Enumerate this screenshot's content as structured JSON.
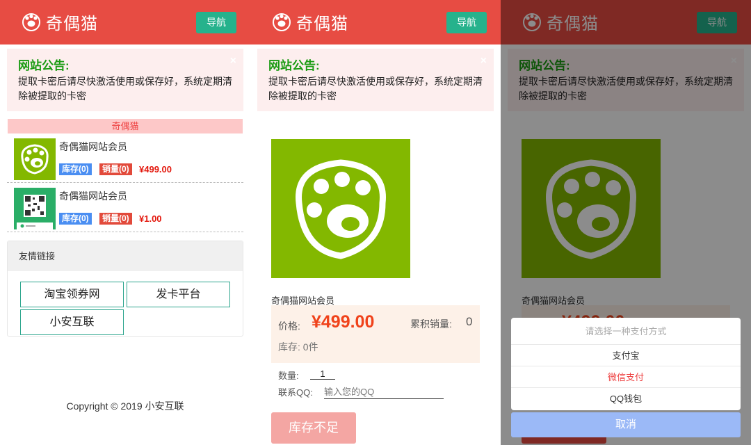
{
  "site": {
    "logo_text": "奇偶猫",
    "nav_label": "导航"
  },
  "notice": {
    "title": "网站公告:",
    "body": "提取卡密后请尽快激活使用或保存好，系统定期清除被提取的卡密",
    "close": "×"
  },
  "category": {
    "name": "奇偶猫"
  },
  "products": [
    {
      "name": "奇偶猫网站会员",
      "stock_label": "库存(0)",
      "sales_label": "销量(0)",
      "price": "¥499.00",
      "thumb_icon": "paw-logo-icon"
    },
    {
      "name": "奇偶猫网站会员",
      "stock_label": "库存(0)",
      "sales_label": "销量(0)",
      "price": "¥1.00",
      "thumb_icon": "wechat-qr-code-icon"
    }
  ],
  "links": {
    "title": "友情链接",
    "items": [
      "淘宝领券网",
      "发卡平台",
      "小安互联"
    ]
  },
  "footer": {
    "copyright": "Copyright © 2019 小安互联"
  },
  "detail": {
    "name": "奇偶猫网站会员",
    "price_label": "价格:",
    "price": "¥499.00",
    "sales_label": "累积销量:",
    "sales_value": "0",
    "stock_text": "库存: 0件",
    "qty_label": "数量:",
    "qty_value": "1",
    "qq_label": "联系QQ:",
    "qq_placeholder": "输入您的QQ",
    "buy_label": "库存不足"
  },
  "payment": {
    "title": "请选择一种支付方式",
    "options": [
      "支付宝",
      "微信支付",
      "QQ钱包"
    ],
    "cancel": "取消"
  },
  "colors": {
    "header": "#e74c43",
    "nav_button": "#26b28c",
    "price": "#f0421a",
    "cancel": "#9bb9f7"
  }
}
